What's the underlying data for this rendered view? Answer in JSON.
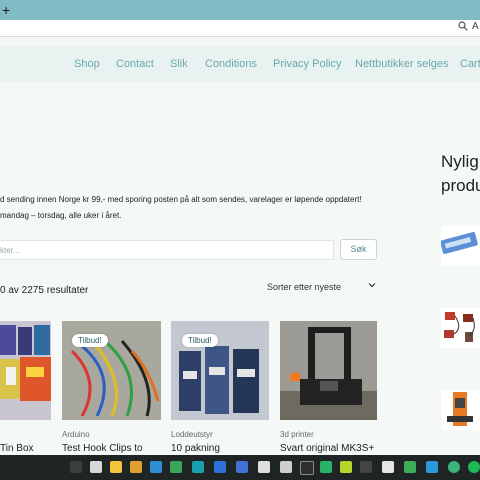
{
  "browser": {
    "new_tab_symbol": "+",
    "zoom_icon": "zoom-icon",
    "reader_label": "A"
  },
  "nav": {
    "items": [
      "Shop",
      "Contact",
      "Slik",
      "Conditions",
      "Privacy Policy",
      "Nettbutikker selges",
      "Cart"
    ]
  },
  "notice": {
    "line1": "d sending innen Norge kr 99,- med sporing posten på alt som sendes, varelager er løpende oppdatert!",
    "line2": "mandag – torsdag, alle uker i året."
  },
  "search": {
    "placeholder": "kter...",
    "button": "Søk"
  },
  "results": {
    "text": "0 av 2275 resultater"
  },
  "sort": {
    "selected": "Sorter etter nyeste"
  },
  "sidebar": {
    "title_line1": "Nylig",
    "title_line2": "produ"
  },
  "products": [
    {
      "category": "",
      "title": "Tin Box",
      "badge": ""
    },
    {
      "category": "Arduino",
      "title": "Test Hook Clips to",
      "badge": "Tilbud!"
    },
    {
      "category": "Loddeutstyr",
      "title": "10 pakning",
      "badge": "Tilbud!"
    },
    {
      "category": "3d printer",
      "title": "Svart original MK3S+",
      "badge": ""
    }
  ],
  "taskbar": {
    "icons": [
      "search-icon",
      "task-view-icon",
      "folder-icon",
      "file-explorer-icon",
      "vscode-icon",
      "app-icon",
      "app-icon",
      "app-icon",
      "app-icon",
      "app-icon",
      "app-icon",
      "app-icon",
      "app-icon",
      "app-icon",
      "app-icon",
      "app-icon",
      "edge-icon",
      "chrome-icon",
      "spotify-icon"
    ]
  }
}
